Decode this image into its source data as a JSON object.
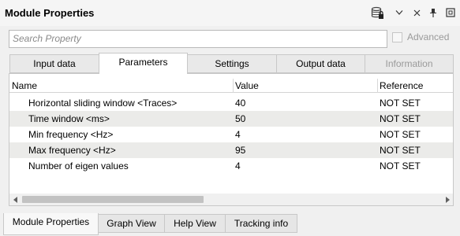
{
  "window": {
    "title": "Module Properties"
  },
  "toolbar": {
    "database_icon": "database-lock-icon",
    "chevron": "v",
    "close": "×",
    "pin": "pin-icon",
    "restore": "restore-icon"
  },
  "search": {
    "placeholder": "Search Property",
    "advanced_label": "Advanced"
  },
  "tabs": [
    {
      "label": "Input data"
    },
    {
      "label": "Parameters"
    },
    {
      "label": "Settings"
    },
    {
      "label": "Output data"
    },
    {
      "label": "Information"
    }
  ],
  "table": {
    "columns": [
      "Name",
      "Value",
      "Reference"
    ],
    "rows": [
      {
        "name": "Horizontal sliding window <Traces>",
        "value": "40",
        "reference": "NOT SET"
      },
      {
        "name": "Time window <ms>",
        "value": "50",
        "reference": "NOT SET"
      },
      {
        "name": "Min frequency <Hz>",
        "value": "4",
        "reference": "NOT SET"
      },
      {
        "name": "Max frequency <Hz>",
        "value": "95",
        "reference": "NOT SET"
      },
      {
        "name": "Number of eigen values",
        "value": "4",
        "reference": "NOT SET"
      }
    ]
  },
  "bottom_tabs": [
    {
      "label": "Module Properties"
    },
    {
      "label": "Graph View"
    },
    {
      "label": "Help View"
    },
    {
      "label": "Tracking info"
    }
  ]
}
